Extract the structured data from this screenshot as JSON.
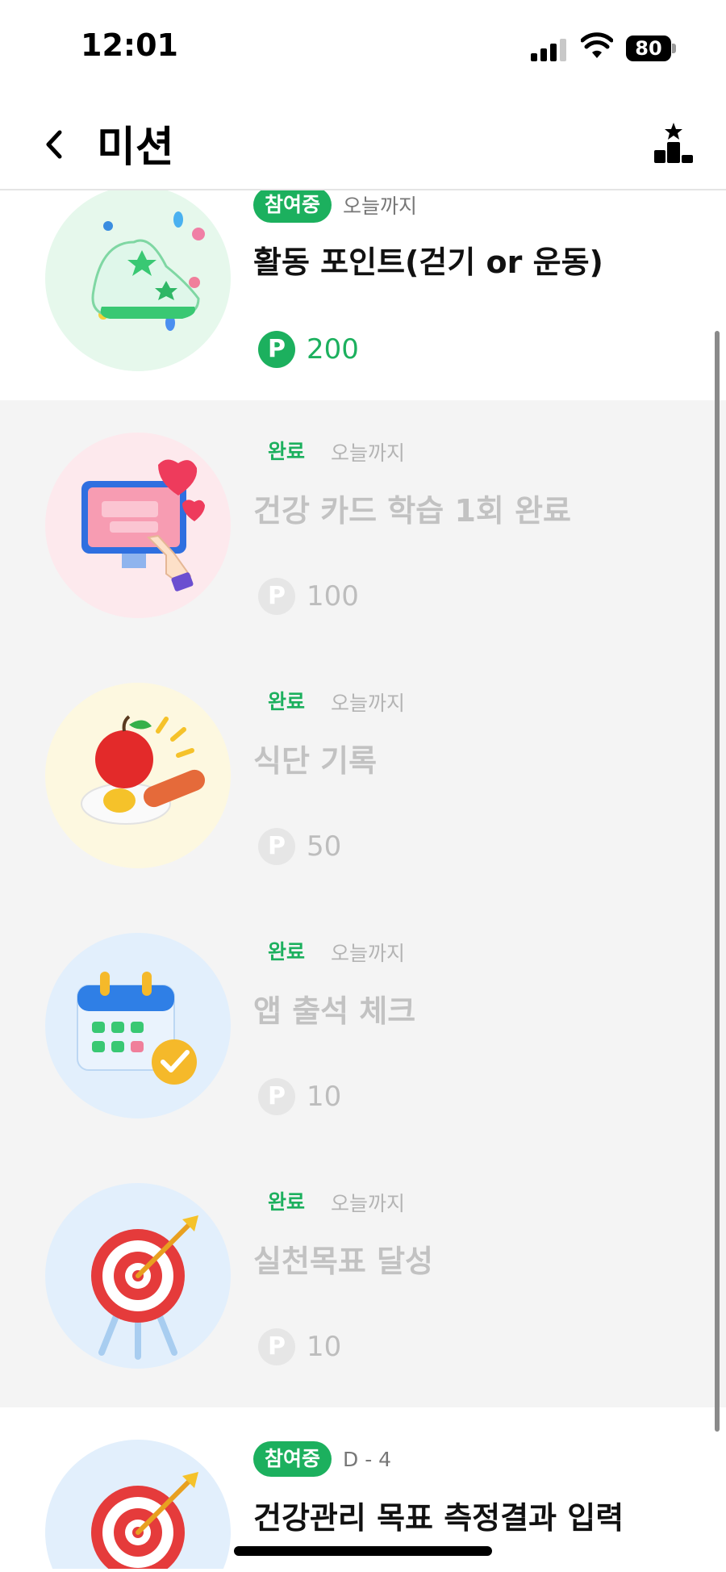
{
  "status_bar": {
    "time": "12:01",
    "battery_level": "80",
    "icons": [
      "signal-icon",
      "wifi-icon",
      "battery-icon"
    ]
  },
  "header": {
    "title": "미션",
    "back_icon": "chevron-left-icon",
    "right_icon": "ranking-podium-icon"
  },
  "missions": [
    {
      "status": "참여중",
      "due": "오늘까지",
      "title": "활동 포인트(걷기 or 운동)",
      "points": "200",
      "point_symbol": "P",
      "icon": "sneaker-icon",
      "state": "active"
    },
    {
      "status": "완료",
      "due": "오늘까지",
      "title": "건강 카드 학습 1회 완료",
      "points": "100",
      "point_symbol": "P",
      "icon": "monitor-heart-icon",
      "state": "completed"
    },
    {
      "status": "완료",
      "due": "오늘까지",
      "title": "식단 기록",
      "points": "50",
      "point_symbol": "P",
      "icon": "meal-icon",
      "state": "completed"
    },
    {
      "status": "완료",
      "due": "오늘까지",
      "title": "앱 출석 체크",
      "points": "10",
      "point_symbol": "P",
      "icon": "calendar-check-icon",
      "state": "completed"
    },
    {
      "status": "완료",
      "due": "오늘까지",
      "title": "실천목표 달성",
      "points": "10",
      "point_symbol": "P",
      "icon": "target-icon",
      "state": "completed"
    },
    {
      "status": "참여중",
      "due": "D - 4",
      "title": "건강관리 목표 측정결과 입력",
      "icon": "target-icon",
      "state": "active"
    }
  ],
  "colors": {
    "accent_green": "#1cb05e",
    "completed_bg": "#f4f4f4",
    "completed_text": "#c2c2c2"
  }
}
